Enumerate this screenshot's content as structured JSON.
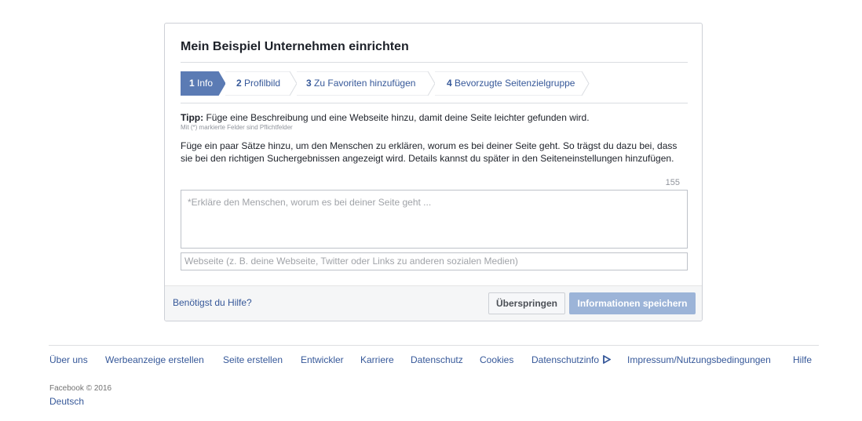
{
  "dialog": {
    "title": "Mein Beispiel Unternehmen einrichten",
    "steps": [
      {
        "num": "1",
        "label": "Info",
        "active": true
      },
      {
        "num": "2",
        "label": "Profilbild",
        "active": false
      },
      {
        "num": "3",
        "label": "Zu Favoriten hinzufügen",
        "active": false
      },
      {
        "num": "4",
        "label": "Bevorzugte Seitenzielgruppe",
        "active": false
      }
    ],
    "tip_label": "Tipp:",
    "tip_text": "Füge eine Beschreibung und eine Webseite hinzu, damit deine Seite leichter gefunden wird.",
    "required_note": "Mit (*) markierte Felder sind Pflichtfelder",
    "description": "Füge ein paar Sätze hinzu, um den Menschen zu erklären, worum es bei deiner Seite geht. So trägst du dazu bei, dass sie bei den richtigen Suchergebnissen angezeigt wird. Details kannst du später in den Seiteneinstellungen hinzufügen.",
    "char_counter": "155",
    "description_placeholder": "*Erkläre den Menschen, worum es bei deiner Seite geht ...",
    "website_placeholder": "Webseite (z. B. deine Webseite, Twitter oder Links zu anderen sozialen Medien)",
    "help_link": "Benötigst du Hilfe?",
    "skip_button": "Überspringen",
    "save_button": "Informationen speichern"
  },
  "footer": {
    "links": [
      "Über uns",
      "Werbeanzeige erstellen",
      "Seite erstellen",
      "Entwickler",
      "Karriere",
      "Datenschutz",
      "Cookies",
      "Datenschutzinfo",
      "Impressum/Nutzungsbedingungen",
      "Hilfe"
    ],
    "adchoices_icon": "adchoices-icon",
    "copyright": "Facebook © 2016",
    "language": "Deutsch"
  },
  "colors": {
    "accent": "#4267b2",
    "link": "#365899",
    "active_step": "#5b7bb4",
    "save_button_disabled": "#9cb4d8"
  }
}
